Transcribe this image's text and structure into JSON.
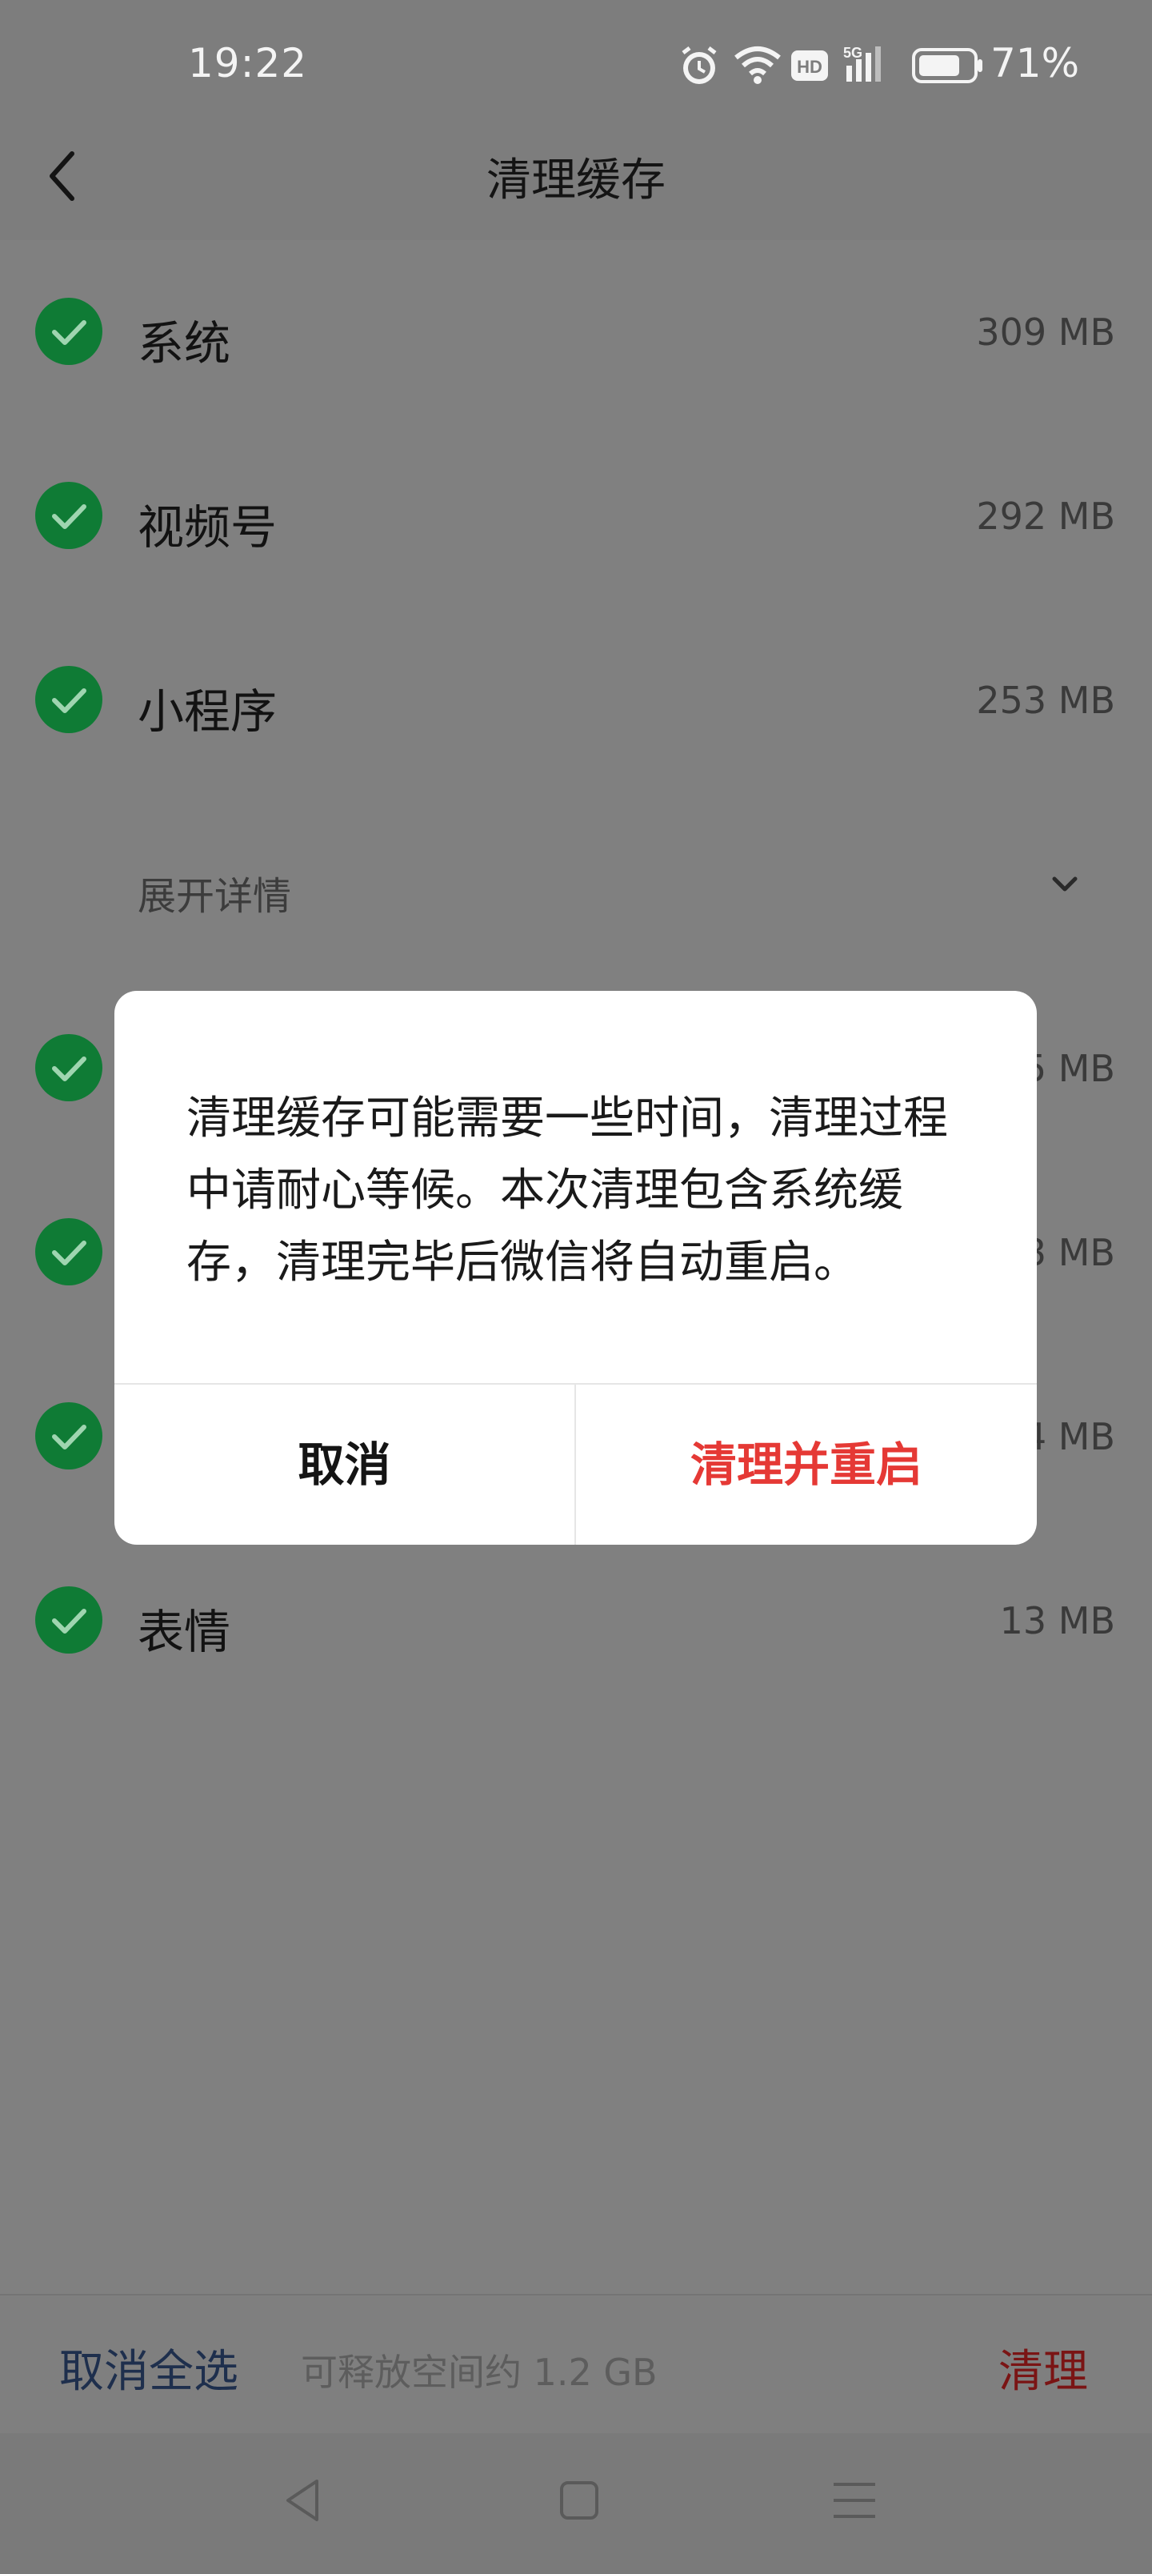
{
  "status_bar": {
    "time": "19:22",
    "battery_percent": "71%",
    "icons": [
      "alarm-icon",
      "wifi-icon",
      "hd-icon",
      "signal-5g-icon",
      "battery-icon"
    ]
  },
  "header": {
    "title": "清理缓存",
    "back_icon": "chevron-left-icon"
  },
  "list": {
    "items": [
      {
        "label": "系统",
        "size": "309 MB",
        "checked": true
      },
      {
        "label": "视频号",
        "size": "292 MB",
        "checked": true
      },
      {
        "label": "小程序",
        "size": "253 MB",
        "checked": true
      }
    ],
    "expand_label": "展开详情",
    "hidden_items": [
      {
        "size_partial": "5 MB",
        "checked": true
      },
      {
        "size_partial": "3 MB",
        "checked": true
      },
      {
        "size_partial": "4 MB",
        "checked": true
      }
    ],
    "last_item": {
      "label": "表情",
      "size": "13 MB",
      "checked": true
    }
  },
  "dialog": {
    "message": "清理缓存可能需要一些时间，清理过程中请耐心等候。本次清理包含系统缓存，清理完毕后微信将自动重启。",
    "cancel_label": "取消",
    "confirm_label": "清理并重启",
    "confirm_color": "#e53935"
  },
  "bottom_bar": {
    "deselect_label": "取消全选",
    "free_space_text": "可释放空间约 1.2 GB",
    "clean_label": "清理"
  },
  "colors": {
    "check_green": "#0f7b35",
    "overlay_gray": "#808080"
  }
}
